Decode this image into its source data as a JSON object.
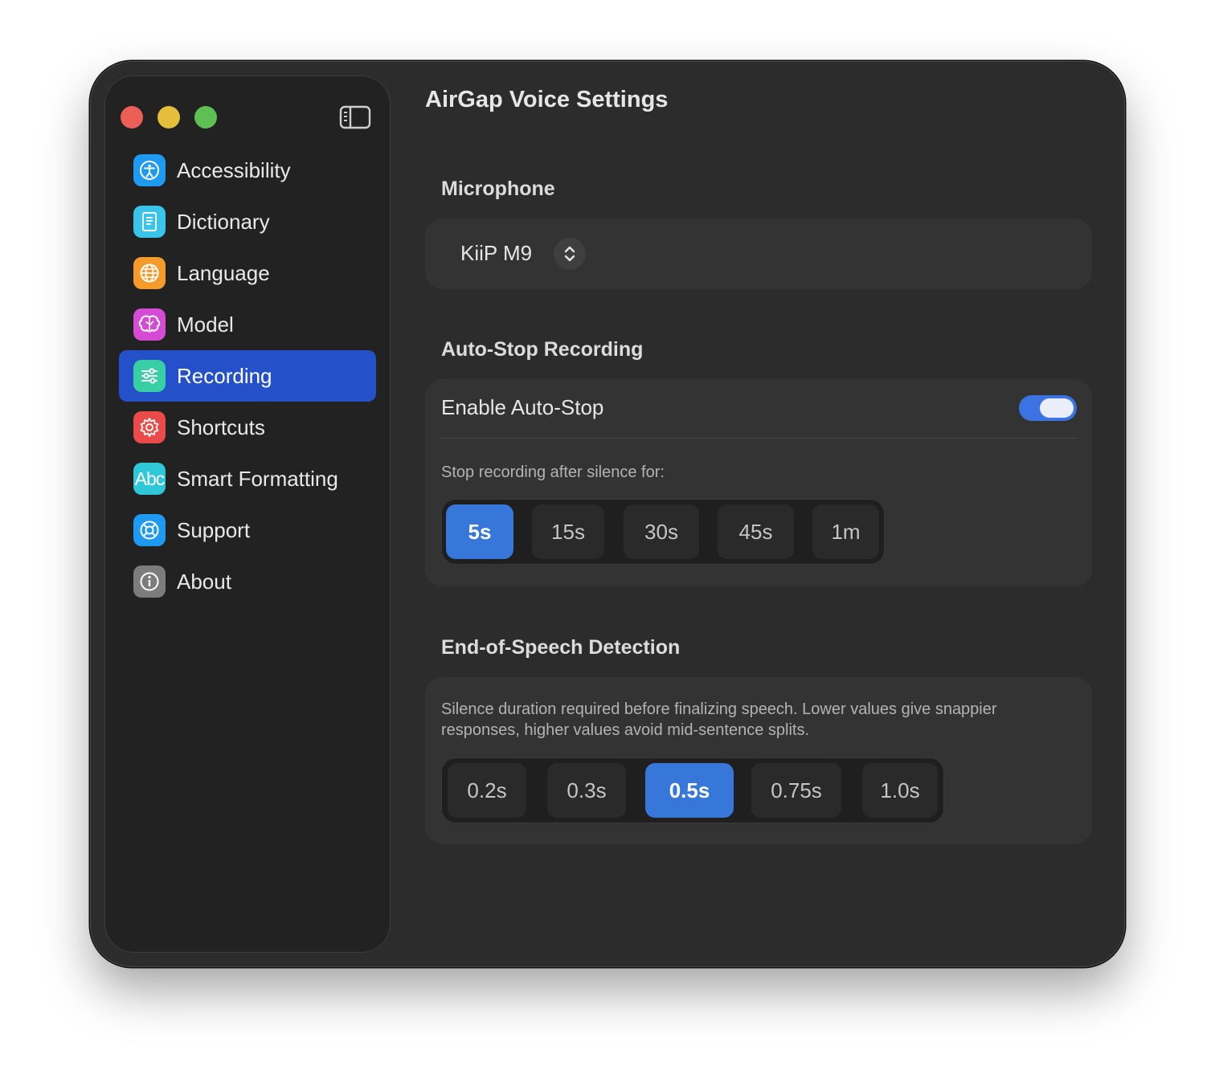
{
  "app": {
    "title": "AirGap Voice Settings"
  },
  "colors": {
    "accent": "#3677d9",
    "selected_nav": "#2451c9",
    "toggle_on": "#3b74e2"
  },
  "sidebar": {
    "items": [
      {
        "label": "Accessibility",
        "icon": "accessibility-icon",
        "color": "#1e9bf0",
        "selected": false
      },
      {
        "label": "Dictionary",
        "icon": "book-icon",
        "color": "#39c4ec",
        "selected": false
      },
      {
        "label": "Language",
        "icon": "globe-icon",
        "color": "#f49b2c",
        "selected": false
      },
      {
        "label": "Model",
        "icon": "brain-icon",
        "color": "#d64bd6",
        "selected": false
      },
      {
        "label": "Recording",
        "icon": "sliders-icon",
        "color": "#39cfa4",
        "selected": true
      },
      {
        "label": "Shortcuts",
        "icon": "gear-icon",
        "color": "#ea4a48",
        "selected": false
      },
      {
        "label": "Smart Formatting",
        "icon": "text-format-icon",
        "color": "#2ec8d8",
        "selected": false
      },
      {
        "label": "Support",
        "icon": "lifebuoy-icon",
        "color": "#1e9bf0",
        "selected": false
      },
      {
        "label": "About",
        "icon": "info-icon",
        "color": "#7c7c7c",
        "selected": false
      }
    ]
  },
  "microphone": {
    "heading": "Microphone",
    "value": "KiiP M9"
  },
  "auto_stop": {
    "heading": "Auto-Stop Recording",
    "toggle_label": "Enable Auto-Stop",
    "enabled": true,
    "caption": "Stop recording after silence for:",
    "options": [
      "5s",
      "15s",
      "30s",
      "45s",
      "1m"
    ],
    "selected": "5s"
  },
  "end_of_speech": {
    "heading": "End-of-Speech Detection",
    "caption_line1": "Silence duration required before finalizing speech. Lower values give snappier",
    "caption_line2": "responses, higher values avoid mid-sentence splits.",
    "options": [
      "0.2s",
      "0.3s",
      "0.5s",
      "0.75s",
      "1.0s"
    ],
    "selected": "0.5s"
  }
}
